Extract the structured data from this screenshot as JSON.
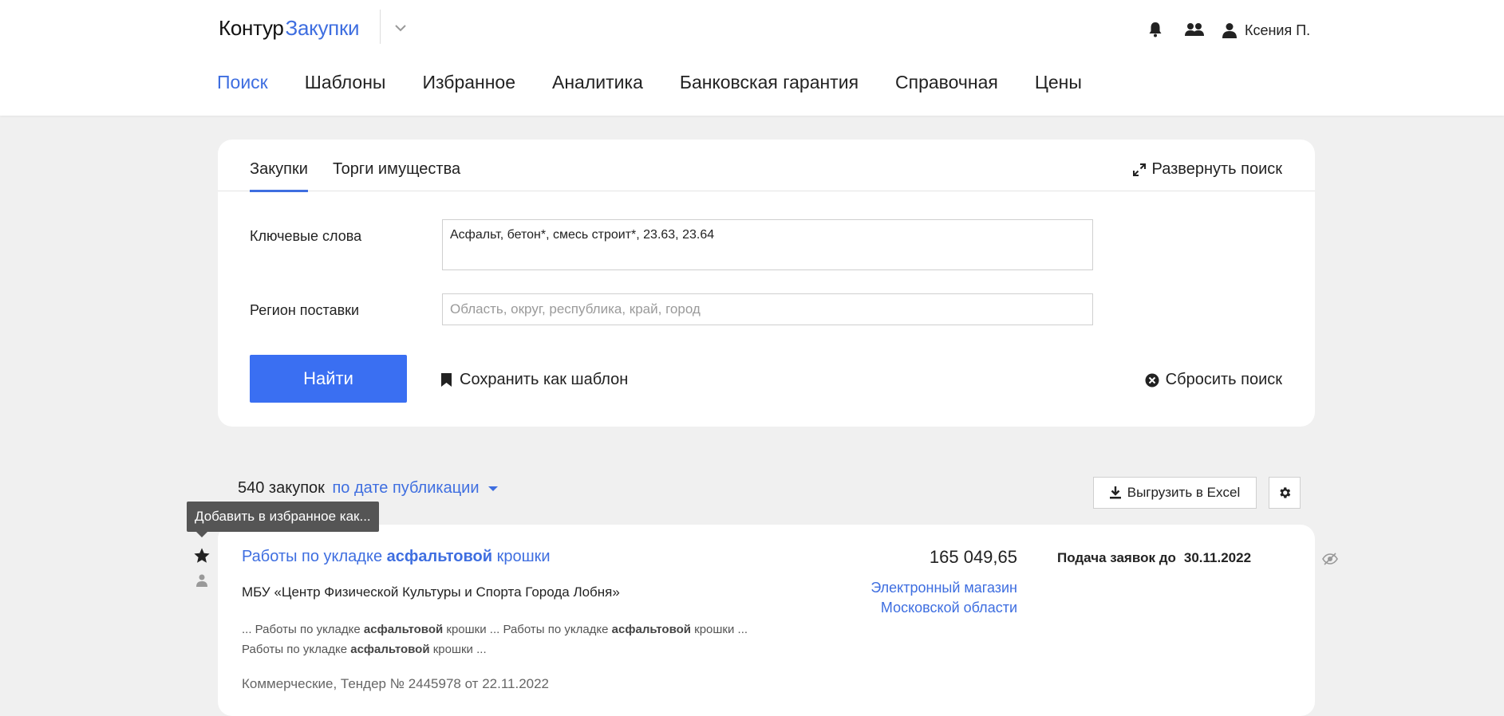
{
  "header": {
    "logo_brand": "Контур",
    "logo_product": "Закупки",
    "user_name": "Ксения П.",
    "nav": [
      "Поиск",
      "Шаблоны",
      "Избранное",
      "Аналитика",
      "Банковская гарантия",
      "Справочная",
      "Цены"
    ],
    "active_nav": "Поиск"
  },
  "search": {
    "tabs": [
      "Закупки",
      "Торги имущества"
    ],
    "active_tab": "Закупки",
    "expand_label": "Развернуть поиск",
    "keywords_label": "Ключевые слова",
    "keywords_value": "Асфальт, бетон*, смесь строит*, 23.63, 23.64",
    "region_label": "Регион поставки",
    "region_placeholder": "Область, округ, республика, край, город",
    "find_label": "Найти",
    "save_template_label": "Сохранить как шаблон",
    "reset_label": "Сбросить поиск"
  },
  "results": {
    "count_text": "540 закупок",
    "sort_label": "по дате публикации",
    "excel_label": "Выгрузить в Excel",
    "tooltip": "Добавить в избранное как...",
    "items": [
      {
        "title_pre": "Работы по укладке ",
        "title_bold": "асфальтовой",
        "title_post": " крошки",
        "org": "МБУ «Центр Физической Культуры и Спорта Города Лобня»",
        "snippet_1a": "... Работы по укладке ",
        "snippet_1b": "асфальтовой",
        "snippet_1c": " крошки ... Работы по укладке ",
        "snippet_1d": "асфальтовой",
        "snippet_1e": " крошки ...",
        "snippet_2a": "Работы по укладке ",
        "snippet_2b": "асфальтовой",
        "snippet_2c": " крошки ...",
        "meta": "Коммерческие, Тендер № 2445978 от 22.11.2022",
        "price": "165 049,65",
        "platform_line1": "Электронный магазин",
        "platform_line2": "Московской области",
        "deadline_label": "Подача заявок до",
        "deadline_date": "30.11.2022"
      }
    ]
  }
}
